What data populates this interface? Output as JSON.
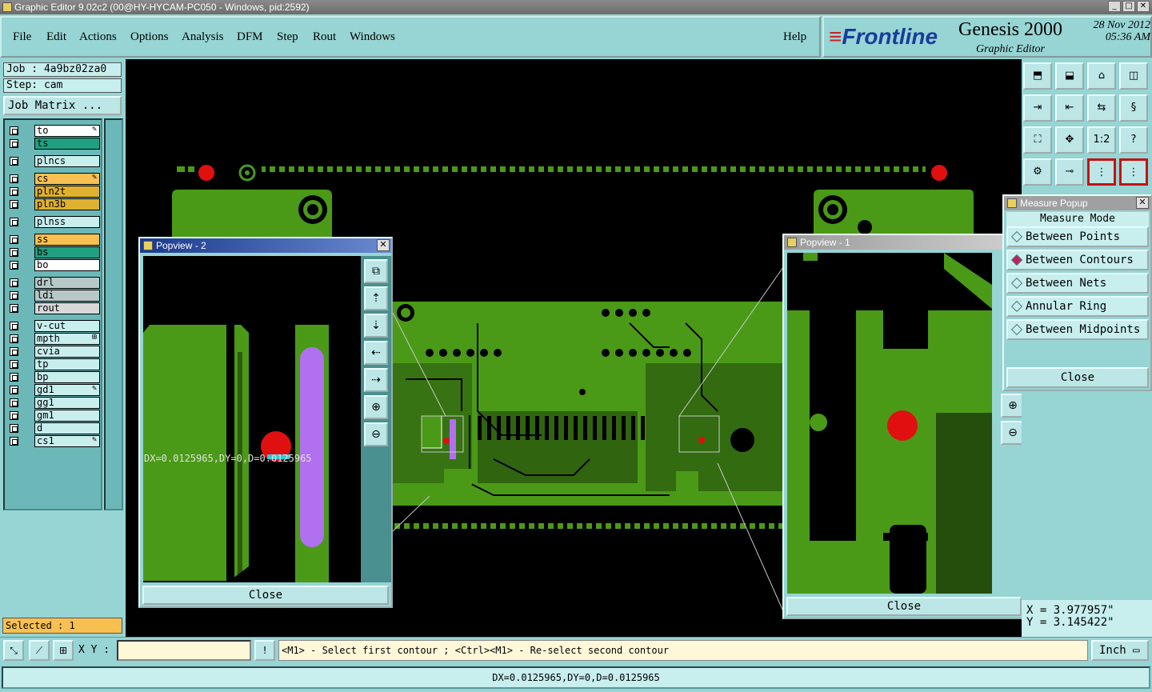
{
  "window": {
    "title": "Graphic Editor 9.02c2 (00@HY-HYCAM-PC050 - Windows, pid:2592)",
    "minimize": "_",
    "maximize": "□",
    "close": "✕"
  },
  "menu": {
    "items": [
      "File",
      "Edit",
      "Actions",
      "Options",
      "Analysis",
      "DFM",
      "Step",
      "Rout",
      "Windows"
    ],
    "help": "Help"
  },
  "branding": {
    "logo": "Frontline",
    "product": "Genesis 2000",
    "subtitle": "Graphic Editor",
    "date": "28 Nov 2012",
    "time": "05:36 AM"
  },
  "job": {
    "job_line": "Job : 4a9bz02za0",
    "step_line": "Step: cam",
    "matrix_button": "Job Matrix ..."
  },
  "layers": [
    {
      "name": "to",
      "color": "#ffffff",
      "mark": "✎"
    },
    {
      "name": "ts",
      "color": "#20a080",
      "mark": ""
    },
    {
      "name": "plncs",
      "color": "#c8eeee",
      "mark": ""
    },
    {
      "name": "cs",
      "color": "#f8c050",
      "mark": "✎"
    },
    {
      "name": "pln2t",
      "color": "#e0b030",
      "mark": ""
    },
    {
      "name": "pln3b",
      "color": "#e0b030",
      "mark": ""
    },
    {
      "name": "plnss",
      "color": "#c8eeee",
      "mark": ""
    },
    {
      "name": "ss",
      "color": "#f8c050",
      "mark": ""
    },
    {
      "name": "bs",
      "color": "#20a080",
      "mark": ""
    },
    {
      "name": "bo",
      "color": "#ffffff",
      "mark": ""
    },
    {
      "name": "drl",
      "color": "#b8c8c8",
      "mark": ""
    },
    {
      "name": "ldi",
      "color": "#b8c8c8",
      "mark": ""
    },
    {
      "name": "rout",
      "color": "#d8d8d8",
      "mark": ""
    },
    {
      "name": "v-cut",
      "color": "#c8eeee",
      "mark": ""
    },
    {
      "name": "mpth",
      "color": "#c8eeee",
      "mark": "⊞"
    },
    {
      "name": "cvia",
      "color": "#c8eeee",
      "mark": ""
    },
    {
      "name": "tp",
      "color": "#c8eeee",
      "mark": ""
    },
    {
      "name": "bp",
      "color": "#c8eeee",
      "mark": ""
    },
    {
      "name": "gd1",
      "color": "#c8eeee",
      "mark": "✎"
    },
    {
      "name": "gg1",
      "color": "#c8eeee",
      "mark": ""
    },
    {
      "name": "gm1",
      "color": "#c8eeee",
      "mark": ""
    },
    {
      "name": "d",
      "color": "#c8eeee",
      "mark": ""
    },
    {
      "name": "cs1",
      "color": "#c8eeee",
      "mark": "✎"
    }
  ],
  "selected_label": "Selected : 1",
  "popview2": {
    "title": "Popview - 2",
    "measurement": "DX=0.0125965,DY=0,D=0.0125965",
    "close": "Close"
  },
  "popview1": {
    "title": "Popview - 1",
    "close": "Close"
  },
  "measure_popup": {
    "title": "Measure Popup",
    "mode_label": "Measure Mode",
    "options": [
      "Between Points",
      "Between Contours",
      "Between Nets",
      "Annular Ring",
      "Between Midpoints"
    ],
    "active_option": "Between Contours",
    "close": "Close"
  },
  "coordinates": {
    "x": "X = 3.977957\"",
    "y": "Y = 3.145422\""
  },
  "command_bar": {
    "xy_label": "X Y :",
    "xy_value": "",
    "info_button": "!",
    "prompt": "<M1> - Select first contour ; <Ctrl><M1> - Re-select second contour",
    "units": "Inch"
  },
  "status": "DX=0.0125965,DY=0,D=0.0125965",
  "colors": {
    "copper": "#4a9a18",
    "pad_red": "#e01010",
    "measure_purple": "#b070f0",
    "background": "#97d4d4"
  }
}
